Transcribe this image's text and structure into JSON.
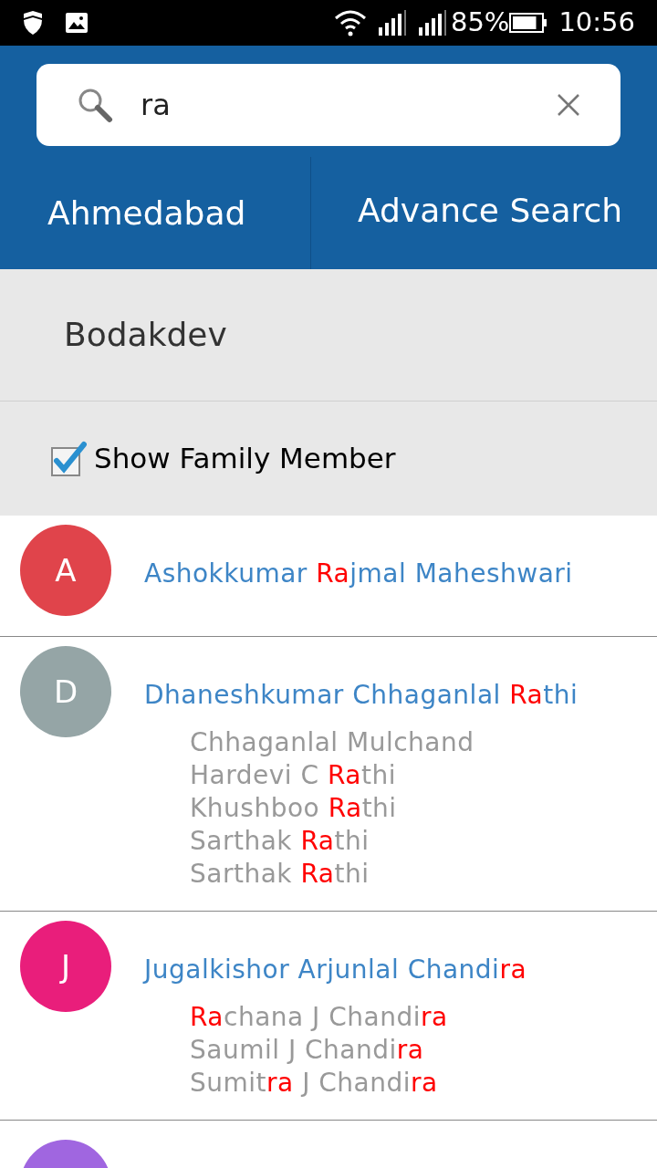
{
  "status_bar": {
    "battery": "85%",
    "time": "10:56"
  },
  "search": {
    "value": "ra"
  },
  "tabs": [
    {
      "label": "Ahmedabad"
    },
    {
      "label": "Advance Search"
    }
  ],
  "area": {
    "label": "Bodakdev"
  },
  "show_family_member": {
    "label": "Show Family Member",
    "checked": true
  },
  "results": [
    {
      "initial": "A",
      "color": "#e0444b",
      "name": [
        {
          "text": "Ashokkumar ",
          "match": false
        },
        {
          "text": "Ra",
          "match": true
        },
        {
          "text": "jmal Maheshwari",
          "match": false
        }
      ]
    },
    {
      "initial": "D",
      "color": "#95a5a6",
      "name": [
        {
          "text": "Dhaneshkumar Chhaganlal ",
          "match": false
        },
        {
          "text": "Ra",
          "match": true
        },
        {
          "text": "thi",
          "match": false
        }
      ],
      "members": [
        [
          {
            "text": "Chhaganlal Mulchand",
            "match": false
          }
        ],
        [
          {
            "text": "Hardevi C ",
            "match": false
          },
          {
            "text": "Ra",
            "match": true
          },
          {
            "text": "thi",
            "match": false
          }
        ],
        [
          {
            "text": "Khushboo ",
            "match": false
          },
          {
            "text": "Ra",
            "match": true
          },
          {
            "text": "thi",
            "match": false
          }
        ],
        [
          {
            "text": "Sarthak ",
            "match": false
          },
          {
            "text": "Ra",
            "match": true
          },
          {
            "text": "thi",
            "match": false
          }
        ],
        [
          {
            "text": "Sarthak ",
            "match": false
          },
          {
            "text": "Ra",
            "match": true
          },
          {
            "text": "thi",
            "match": false
          }
        ]
      ]
    },
    {
      "initial": "J",
      "color": "#e91e7b",
      "name": [
        {
          "text": "Jugalkishor Arjunlal Chandi",
          "match": false
        },
        {
          "text": "ra",
          "match": true
        }
      ],
      "members": [
        [
          {
            "text": "Ra",
            "match": true
          },
          {
            "text": "chana J Chandi",
            "match": false
          },
          {
            "text": "ra",
            "match": true
          }
        ],
        [
          {
            "text": "Saumil J Chandi",
            "match": false
          },
          {
            "text": "ra",
            "match": true
          }
        ],
        [
          {
            "text": "Sumit",
            "match": false
          },
          {
            "text": "ra",
            "match": true
          },
          {
            "text": " J Chandi",
            "match": false
          },
          {
            "text": "ra",
            "match": true
          }
        ]
      ]
    },
    {
      "color": "#a066e0"
    }
  ]
}
